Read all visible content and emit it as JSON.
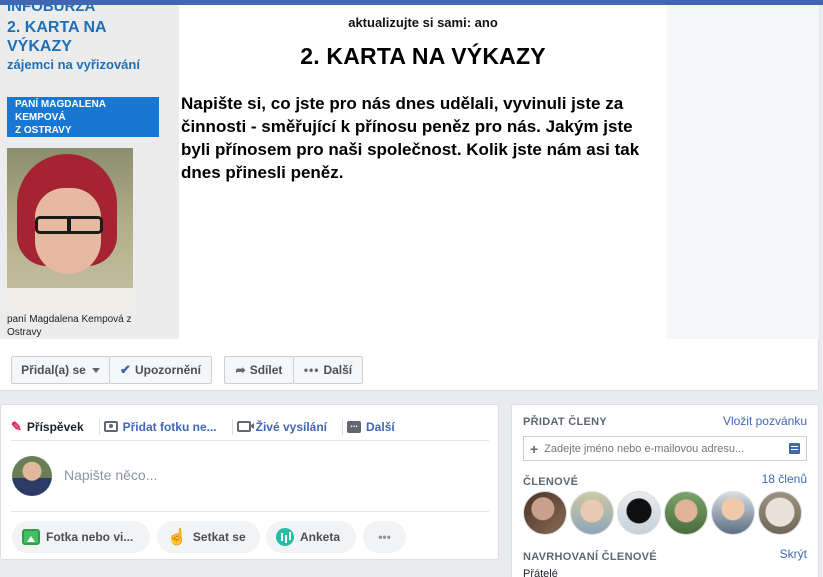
{
  "cover": {
    "left_title1": "INFOBURZA",
    "left_title2a": "2. KARTA NA",
    "left_title2b": "VÝKAZY",
    "left_sub": "zájemci na vyřizování",
    "name_box": [
      "PANÍ MAGDALENA",
      "KEMPOVÁ",
      "Z OSTRAVY"
    ],
    "photo_caption": "paní Magdalena Kempová z Ostravy",
    "subtitle": "aktualizujte si sami: ano",
    "title": "2. KARTA NA VÝKAZY",
    "body": "Napište si, co jste pro nás dnes udělali, vyvinuli jste za činnosti - směřující k přínosu peněz pro nás. Jakým jste byli přínosem pro naši společnost. Kolik jste nám asi tak dnes přinesli peněz."
  },
  "cover_actions": {
    "joined": "Přidal(a) se",
    "notifications": "Upozornění",
    "share": "Sdílet",
    "more": "Další"
  },
  "composer": {
    "tabs": [
      "Příspěvek",
      "Přidat fotku ne...",
      "Živé vysílání",
      "Další"
    ],
    "placeholder": "Napište něco...",
    "pills": [
      "Fotka nebo vi...",
      "Setkat se",
      "Anketa"
    ]
  },
  "sidebar": {
    "add_members": "PŘIDAT ČLENY",
    "invite": "Vložit pozvánku",
    "input_placeholder": "Zadejte jméno nebo e-mailovou adresu...",
    "members_label": "ČLENOVÉ",
    "members_count": "18 členů",
    "suggested": "NAVRHOVANÍ ČLENOVÉ",
    "hide": "Skrýt",
    "friends": "Přátelé"
  },
  "colors": {
    "accent": "#4267b2",
    "page_bg": "#e9ebee",
    "cover_blue": "#1d6fb8",
    "name_box_bg": "#1877d2"
  }
}
